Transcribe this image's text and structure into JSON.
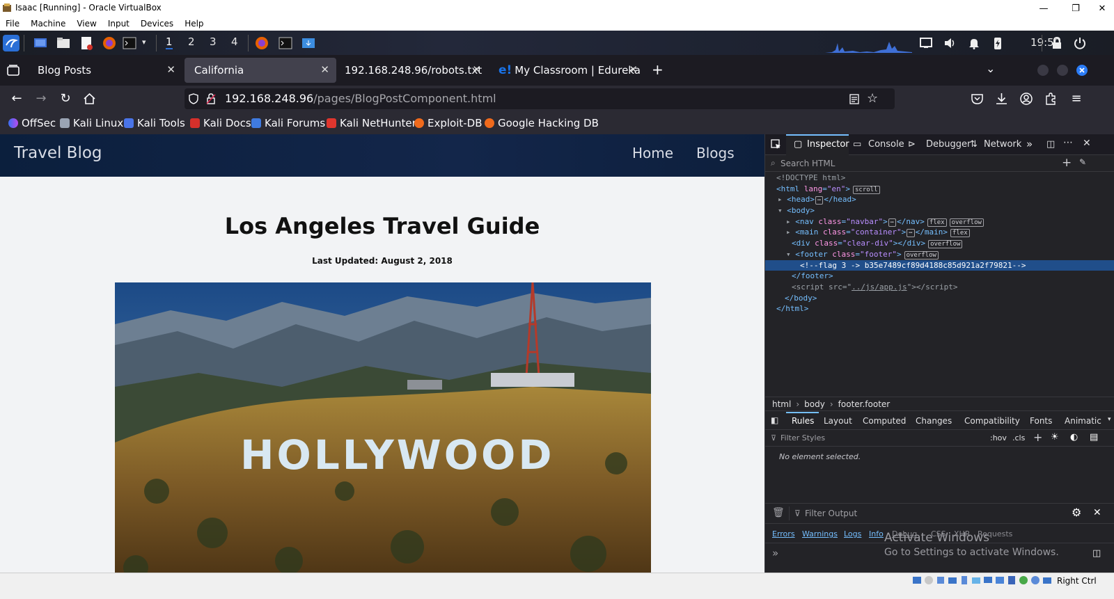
{
  "vbox": {
    "title": "Isaac [Running] - Oracle VirtualBox",
    "menu": [
      "File",
      "Machine",
      "View",
      "Input",
      "Devices",
      "Help"
    ],
    "minimize": "—",
    "restore": "❐",
    "close": "✕",
    "status_right": "Right Ctrl"
  },
  "panel": {
    "workspaces": [
      "1",
      "2",
      "3",
      "4"
    ],
    "clock": "19:50"
  },
  "firefox": {
    "tabs": [
      {
        "label": "Blog Posts"
      },
      {
        "label": "California"
      },
      {
        "label": "192.168.248.96/robots.txt"
      },
      {
        "label": "My Classroom | Edureka"
      }
    ],
    "active_tab": "California",
    "url_host": "192.168.248.96",
    "url_path": "/pages/BlogPostComponent.html",
    "bookmarks": [
      "OffSec",
      "Kali Linux",
      "Kali Tools",
      "Kali Docs",
      "Kali Forums",
      "Kali NetHunter",
      "Exploit-DB",
      "Google Hacking DB"
    ]
  },
  "site": {
    "brand": "Travel Blog",
    "nav": [
      "Home",
      "Blogs"
    ],
    "post_title": "Los Angeles Travel Guide",
    "post_date": "Last Updated: August 2, 2018",
    "image_sign": "HOLLYWOOD"
  },
  "devtools": {
    "tabs": [
      "Inspector",
      "Console",
      "Debugger",
      "Network"
    ],
    "search_placeholder": "Search HTML",
    "tree": {
      "doctype": "<!DOCTYPE html>",
      "html_open": "html",
      "lang_attr": "lang",
      "lang_val": "\"en\"",
      "head": "head",
      "body": "body",
      "nav_class": "\"navbar\"",
      "main_class": "\"container\"",
      "div_class": "\"clear-div\"",
      "footer_class": "\"footer\"",
      "comment": "<!--flag 3 -> b35e7489cf89d4188c85d921a2f79821-->",
      "script_src": "../js/app.js",
      "badge_scroll": "scroll",
      "badge_flex": "flex",
      "badge_overflow": "overflow"
    },
    "breadcrumb": [
      "html",
      "body",
      "footer.footer"
    ],
    "rules_tabs": [
      "Rules",
      "Layout",
      "Computed",
      "Changes",
      "Compatibility",
      "Fonts",
      "Animatic"
    ],
    "filter_styles": "Filter Styles",
    "hov": ":hov",
    "cls": ".cls",
    "no_element": "No element selected.",
    "filter_output": "Filter Output",
    "levels": [
      "Errors",
      "Warnings",
      "Logs",
      "Info",
      "Debug",
      "CSS",
      "XHR",
      "Requests"
    ],
    "activate_title": "Activate Windows",
    "activate_sub": "Go to Settings to activate Windows."
  }
}
